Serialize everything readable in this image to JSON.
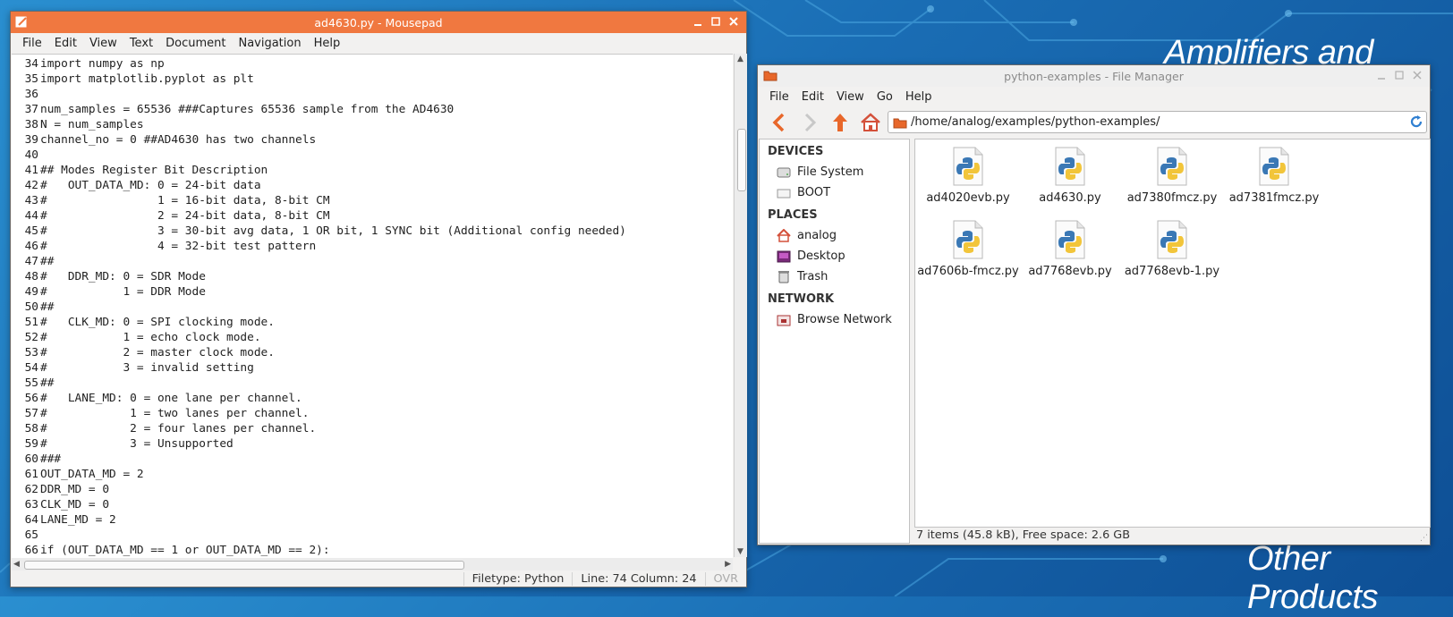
{
  "colors": {
    "editor_titlebar": "#f07840",
    "desktop_blue": "#1a6db4",
    "file_accent": "#3a78b5"
  },
  "desktop": {
    "text_top": "Amplifiers and Linear",
    "text_bottom": "Other Products"
  },
  "editor": {
    "title": "ad4630.py - Mousepad",
    "menu": [
      "File",
      "Edit",
      "View",
      "Text",
      "Document",
      "Navigation",
      "Help"
    ],
    "lines": [
      {
        "n": "34",
        "t": "import numpy as np"
      },
      {
        "n": "35",
        "t": "import matplotlib.pyplot as plt"
      },
      {
        "n": "36",
        "t": ""
      },
      {
        "n": "37",
        "t": "num_samples = 65536 ###Captures 65536 sample from the AD4630"
      },
      {
        "n": "38",
        "t": "N = num_samples"
      },
      {
        "n": "39",
        "t": "channel_no = 0 ##AD4630 has two channels"
      },
      {
        "n": "40",
        "t": ""
      },
      {
        "n": "41",
        "t": "## Modes Register Bit Description"
      },
      {
        "n": "42",
        "t": "#   OUT_DATA_MD: 0 = 24-bit data"
      },
      {
        "n": "43",
        "t": "#                1 = 16-bit data, 8-bit CM"
      },
      {
        "n": "44",
        "t": "#                2 = 24-bit data, 8-bit CM"
      },
      {
        "n": "45",
        "t": "#                3 = 30-bit avg data, 1 OR bit, 1 SYNC bit (Additional config needed)"
      },
      {
        "n": "46",
        "t": "#                4 = 32-bit test pattern"
      },
      {
        "n": "47",
        "t": "##"
      },
      {
        "n": "48",
        "t": "#   DDR_MD: 0 = SDR Mode"
      },
      {
        "n": "49",
        "t": "#           1 = DDR Mode"
      },
      {
        "n": "50",
        "t": "##"
      },
      {
        "n": "51",
        "t": "#   CLK_MD: 0 = SPI clocking mode."
      },
      {
        "n": "52",
        "t": "#           1 = echo clock mode."
      },
      {
        "n": "53",
        "t": "#           2 = master clock mode."
      },
      {
        "n": "54",
        "t": "#           3 = invalid setting"
      },
      {
        "n": "55",
        "t": "##"
      },
      {
        "n": "56",
        "t": "#   LANE_MD: 0 = one lane per channel."
      },
      {
        "n": "57",
        "t": "#            1 = two lanes per channel."
      },
      {
        "n": "58",
        "t": "#            2 = four lanes per channel."
      },
      {
        "n": "59",
        "t": "#            3 = Unsupported"
      },
      {
        "n": "60",
        "t": "###"
      },
      {
        "n": "61",
        "t": "OUT_DATA_MD = 2"
      },
      {
        "n": "62",
        "t": "DDR_MD = 0"
      },
      {
        "n": "63",
        "t": "CLK_MD = 0"
      },
      {
        "n": "64",
        "t": "LANE_MD = 2"
      },
      {
        "n": "65",
        "t": ""
      },
      {
        "n": "66",
        "t": "if (OUT_DATA_MD == 1 or OUT_DATA_MD == 2):"
      }
    ],
    "status": {
      "filetype": "Filetype: Python",
      "position": "Line: 74 Column: 24",
      "mode": "OVR"
    }
  },
  "filemanager": {
    "title": "python-examples - File Manager",
    "menu": [
      "File",
      "Edit",
      "View",
      "Go",
      "Help"
    ],
    "path": "/home/analog/examples/python-examples/",
    "sidebar": {
      "devices_header": "DEVICES",
      "devices": [
        {
          "label": "File System",
          "icon": "harddisk-icon"
        },
        {
          "label": "BOOT",
          "icon": "drive-icon"
        }
      ],
      "places_header": "PLACES",
      "places": [
        {
          "label": "analog",
          "icon": "home-icon"
        },
        {
          "label": "Desktop",
          "icon": "desktop-icon"
        },
        {
          "label": "Trash",
          "icon": "trash-icon"
        }
      ],
      "network_header": "NETWORK",
      "network": [
        {
          "label": "Browse Network",
          "icon": "network-icon"
        }
      ]
    },
    "files": [
      "ad4020evb.py",
      "ad4630.py",
      "ad7380fmcz.py",
      "ad7381fmcz.py",
      "ad7606b-fmcz.py",
      "ad7768evb.py",
      "ad7768evb-1.py"
    ],
    "status": "7 items (45.8 kB), Free space: 2.6 GB"
  }
}
